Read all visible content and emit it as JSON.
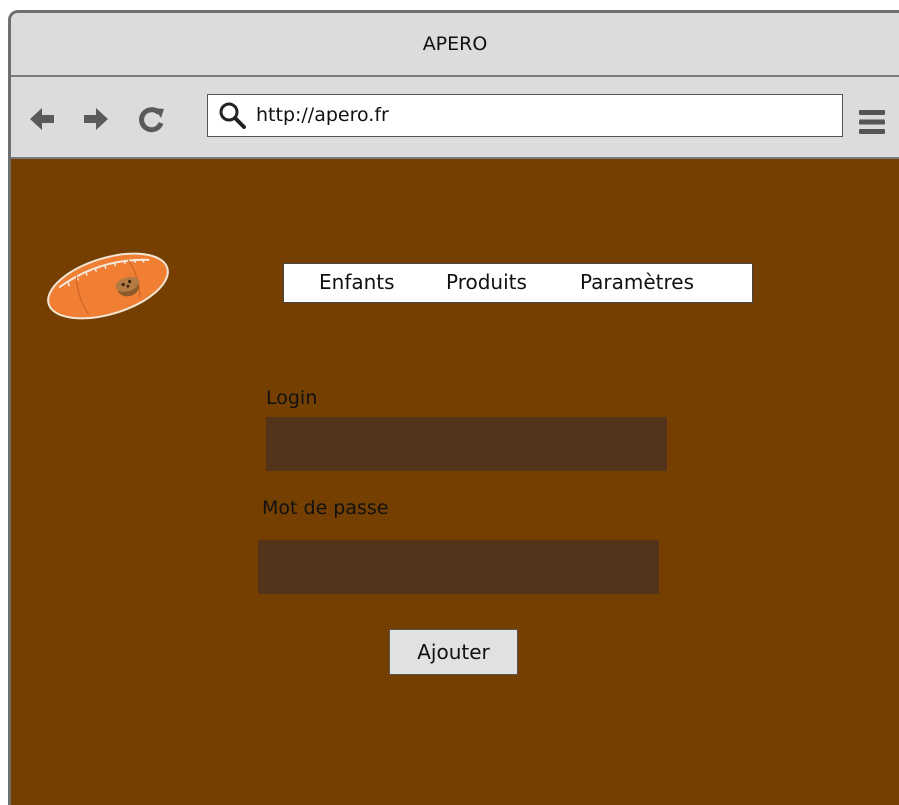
{
  "window": {
    "title": "APERO"
  },
  "toolbar": {
    "url": "http://apero.fr",
    "icons": [
      "back-arrow-icon",
      "forward-arrow-icon",
      "reload-icon",
      "search-icon",
      "menu-icon"
    ]
  },
  "colors": {
    "page_background": "#753f01",
    "input_background": "#53341b",
    "chrome": "#dcdcdc",
    "logo_ball": "#f07f34"
  },
  "nav": {
    "items": [
      {
        "label": "Enfants"
      },
      {
        "label": "Produits"
      },
      {
        "label": "Paramètres"
      }
    ]
  },
  "form": {
    "login_label": "Login",
    "login_value": "",
    "password_label": "Mot de passe",
    "password_value": "",
    "submit_label": "Ajouter"
  },
  "logo": {
    "icon": "football-muffin-logo"
  }
}
